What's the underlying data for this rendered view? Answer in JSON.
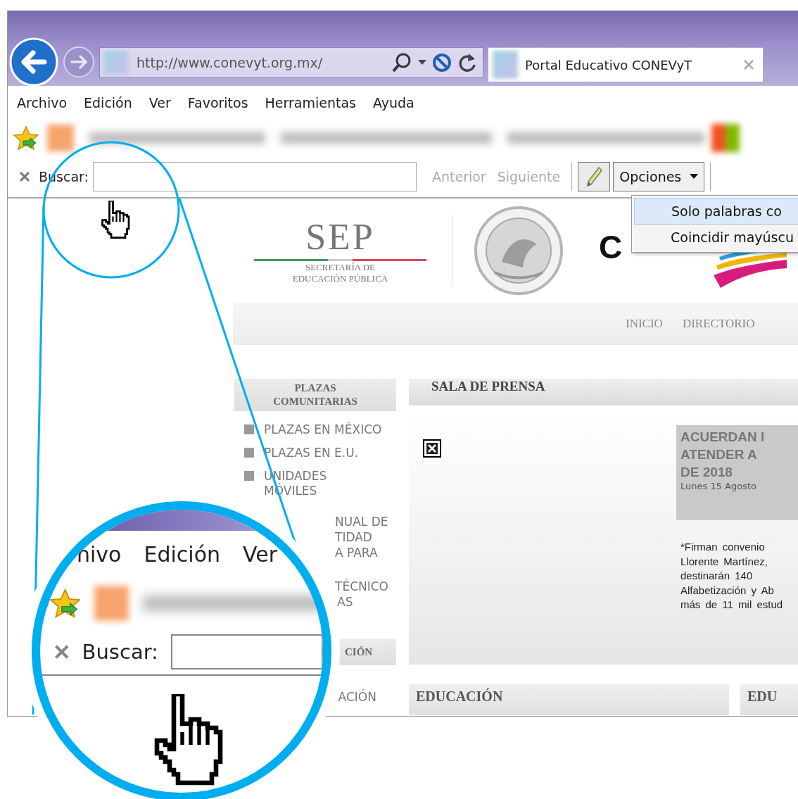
{
  "browser": {
    "address": "http://www.conevyt.org.mx/",
    "tab": {
      "title": "Portal Educativo CONEVyT",
      "selected": true
    },
    "menu": [
      "Archivo",
      "Edición",
      "Ver",
      "Favoritos",
      "Herramientas",
      "Ayuda"
    ],
    "find_bar": {
      "label": "Buscar:",
      "previous": {
        "label": "Anterior",
        "disabled": true
      },
      "next": {
        "label": "Siguiente",
        "disabled": true
      },
      "options": "Opciones",
      "options_menu": [
        {
          "label": "Solo palabras co",
          "selected": true
        },
        {
          "label": "Coincidir mayúscu",
          "selected": false
        }
      ]
    }
  },
  "page": {
    "sep_logo": {
      "title": "SEP",
      "line_1": "SECRETARÍA DE",
      "line_2": "EDUCACIÓN PÚBLICA"
    },
    "conevyt_logo": "C",
    "nav": [
      "INICIO",
      "DIRECTORIO"
    ],
    "sidebar": [
      {
        "kind": "header",
        "text": "PLAZAS\nCOMUNITARIAS"
      },
      {
        "kind": "link",
        "text": "PLAZAS EN MÉXICO"
      },
      {
        "kind": "link",
        "text": "PLAZAS EN E.U."
      },
      {
        "kind": "link",
        "text": "UNIDADES\nMÓVILES"
      },
      {
        "kind": "fragment",
        "lines": [
          "NUAL DE",
          "TIDAD",
          "A PARA"
        ]
      },
      {
        "kind": "fragment",
        "lines": [
          "TÉCNICO",
          "AS"
        ]
      },
      {
        "kind": "header_fragment",
        "lines": [
          "CIÓN"
        ]
      },
      {
        "kind": "fragment",
        "lines": [
          "ACIÓN"
        ]
      }
    ],
    "press": {
      "title": "SALA DE PRENSA",
      "headline": "ACUERDAN I\nATENDER A\nDE 2018",
      "date": "Lunes 15 Agosto",
      "summary": "*Firman convenio\nLlorente Martínez,\ndestinarán 140\nAlfabetización y Ab\nmás de 11 mil estud"
    },
    "bottom_headers": [
      "EDUCACIÓN",
      "EDU"
    ]
  },
  "magnifier": {
    "menu": [
      "hivo",
      "Edición",
      "Ver"
    ],
    "find_label": "Buscar:"
  }
}
